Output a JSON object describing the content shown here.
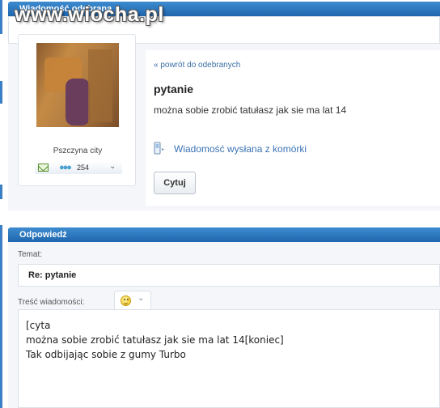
{
  "inbox_panel": {
    "title": "Wiadomość odebrana",
    "watermark": "www.wiocha.pl"
  },
  "sender": {
    "name": "Pszczyna city",
    "friends_count": "254"
  },
  "message": {
    "back_link": "« powrót do odebranych",
    "subject": "pytanie",
    "body": "można sobie zrobić tatułasz jak sie ma lat 14",
    "sent_note": "Wiadomość wysłana z komórki",
    "quote_button": "Cytuj"
  },
  "reply_panel": {
    "title": "Odpowiedź",
    "subject_label": "Temat:",
    "subject_value": "Re: pytanie",
    "content_label": "Treść wiadomości:",
    "content_lines": [
      "[cyta",
      "można sobie zrobić tatułasz jak sie ma lat 14[koniec]",
      "Tak odbijając sobie z gumy Turbo"
    ]
  },
  "colors": {
    "header_blue": "#1f66ad",
    "link_blue": "#3b6fa6",
    "panel_bg": "#f4f6f9"
  }
}
